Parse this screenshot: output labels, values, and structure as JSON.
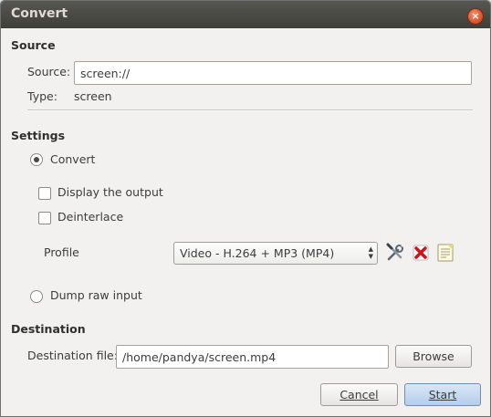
{
  "window": {
    "title": "Convert",
    "close_glyph": "×"
  },
  "source": {
    "heading": "Source",
    "source_label": "Source:",
    "source_value": "screen://",
    "type_label": "Type:",
    "type_value": "screen"
  },
  "settings": {
    "heading": "Settings",
    "convert_label": "Convert",
    "convert_selected": true,
    "display_output_label": "Display the output",
    "display_output_checked": false,
    "deinterlace_label": "Deinterlace",
    "deinterlace_checked": false,
    "profile_label": "Profile",
    "profile_value": "Video - H.264 + MP3 (MP4)",
    "profile_buttons": [
      "edit-profile-icon",
      "delete-profile-icon",
      "new-profile-icon"
    ],
    "dump_raw_label": "Dump raw input",
    "dump_raw_selected": false
  },
  "destination": {
    "heading": "Destination",
    "file_label": "Destination file:",
    "file_value": "/home/pandya/screen.mp4",
    "browse_label": "Browse"
  },
  "actions": {
    "cancel_label": "Cancel",
    "start_label": "Start"
  },
  "colors": {
    "titlebar": "#4a4a45",
    "window_bg": "#f2f1f0",
    "accent_button": "#b4cdea",
    "close_button": "#e0562c"
  }
}
